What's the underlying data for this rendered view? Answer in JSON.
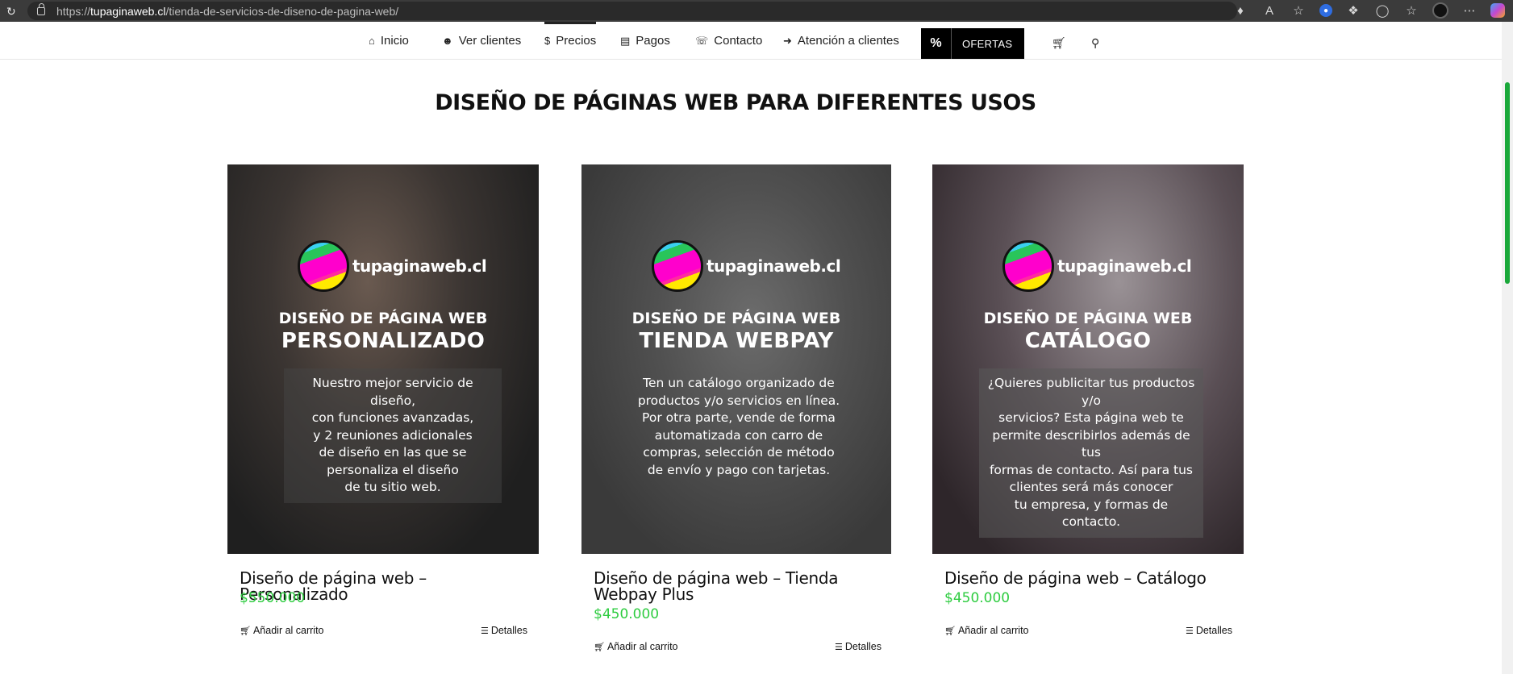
{
  "browser": {
    "url_prefix": "https://",
    "url_domain": "tupaginaweb.cl",
    "url_path": "/tienda-de-servicios-de-diseno-de-pagina-web/"
  },
  "nav": {
    "items": [
      {
        "label": "Inicio",
        "icon": "home-icon"
      },
      {
        "label": "Ver clientes",
        "icon": "smile-icon"
      },
      {
        "label": "Precios",
        "icon": "dollar-icon"
      },
      {
        "label": "Pagos",
        "icon": "credit-card-icon"
      },
      {
        "label": "Contacto",
        "icon": "whatsapp-icon"
      },
      {
        "label": "Atención a clientes",
        "icon": "sign-in-icon"
      }
    ],
    "active": "Precios",
    "ofertas_label": "OFERTAS"
  },
  "page": {
    "title": "DISEÑO DE PÁGINAS WEB PARA DIFERENTES USOS"
  },
  "products": [
    {
      "logo_text": "tupaginaweb.cl",
      "img_subtitle": "DISEÑO DE PÁGINA WEB",
      "img_headline": "PERSONALIZADO",
      "img_desc": "Nuestro mejor servicio de diseño,\ncon funciones avanzadas,\ny 2 reuniones adicionales\nde diseño en las que se\npersonaliza el diseño\nde tu sitio web.",
      "title": "Diseño de página web – Personalizado",
      "price": "$550.000",
      "add_to_cart": "Añadir al carrito",
      "details": "Detalles"
    },
    {
      "logo_text": "tupaginaweb.cl",
      "img_subtitle": "DISEÑO DE PÁGINA WEB",
      "img_headline": "TIENDA WEBPAY",
      "img_desc": "Ten un catálogo organizado de\nproductos y/o servicios en línea.\nPor otra parte, vende de forma\nautomatizada con carro de\ncompras, selección de método\nde envío y pago con tarjetas.",
      "title": "Diseño de página web – Tienda Webpay Plus",
      "price": "$450.000",
      "add_to_cart": "Añadir al carrito",
      "details": "Detalles"
    },
    {
      "logo_text": "tupaginaweb.cl",
      "img_subtitle": "DISEÑO DE PÁGINA WEB",
      "img_headline": "CATÁLOGO",
      "img_desc": "¿Quieres publicitar tus productos y/o\nservicios? Esta página web te\npermite describirlos además de tus\nformas de contacto. Así para tus\nclientes será más conocer\ntu empresa, y formas de contacto.",
      "title": "Diseño de página web – Catálogo",
      "price": "$450.000",
      "add_to_cart": "Añadir al carrito",
      "details": "Detalles"
    }
  ],
  "colors": {
    "price_green": "#2ecc40",
    "scrollbar_green": "#1aa83a",
    "nav_dark": "#000000"
  }
}
